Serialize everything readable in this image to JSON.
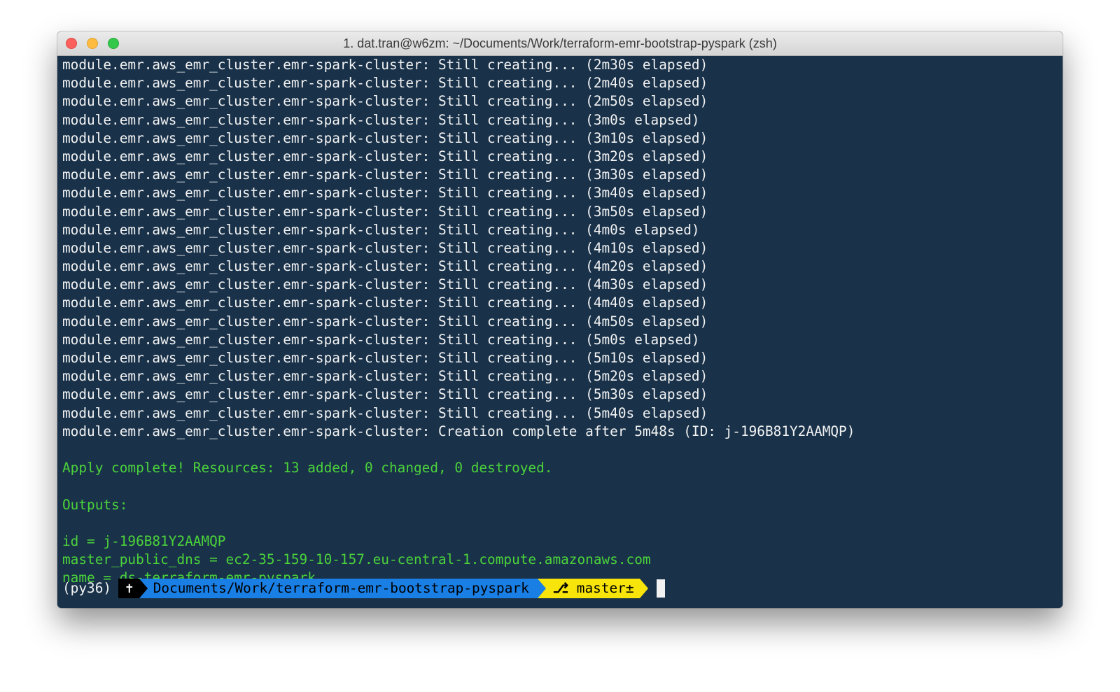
{
  "window": {
    "title": "1. dat.tran@w6zm: ~/Documents/Work/terraform-emr-bootstrap-pyspark (zsh)"
  },
  "terminal": {
    "lines": [
      {
        "text": "module.emr.aws_emr_cluster.emr-spark-cluster: Still creating... (2m30s elapsed)",
        "style": "normal"
      },
      {
        "text": "module.emr.aws_emr_cluster.emr-spark-cluster: Still creating... (2m40s elapsed)",
        "style": "normal"
      },
      {
        "text": "module.emr.aws_emr_cluster.emr-spark-cluster: Still creating... (2m50s elapsed)",
        "style": "normal"
      },
      {
        "text": "module.emr.aws_emr_cluster.emr-spark-cluster: Still creating... (3m0s elapsed)",
        "style": "normal"
      },
      {
        "text": "module.emr.aws_emr_cluster.emr-spark-cluster: Still creating... (3m10s elapsed)",
        "style": "normal"
      },
      {
        "text": "module.emr.aws_emr_cluster.emr-spark-cluster: Still creating... (3m20s elapsed)",
        "style": "normal"
      },
      {
        "text": "module.emr.aws_emr_cluster.emr-spark-cluster: Still creating... (3m30s elapsed)",
        "style": "normal"
      },
      {
        "text": "module.emr.aws_emr_cluster.emr-spark-cluster: Still creating... (3m40s elapsed)",
        "style": "normal"
      },
      {
        "text": "module.emr.aws_emr_cluster.emr-spark-cluster: Still creating... (3m50s elapsed)",
        "style": "normal"
      },
      {
        "text": "module.emr.aws_emr_cluster.emr-spark-cluster: Still creating... (4m0s elapsed)",
        "style": "normal"
      },
      {
        "text": "module.emr.aws_emr_cluster.emr-spark-cluster: Still creating... (4m10s elapsed)",
        "style": "normal"
      },
      {
        "text": "module.emr.aws_emr_cluster.emr-spark-cluster: Still creating... (4m20s elapsed)",
        "style": "normal"
      },
      {
        "text": "module.emr.aws_emr_cluster.emr-spark-cluster: Still creating... (4m30s elapsed)",
        "style": "normal"
      },
      {
        "text": "module.emr.aws_emr_cluster.emr-spark-cluster: Still creating... (4m40s elapsed)",
        "style": "normal"
      },
      {
        "text": "module.emr.aws_emr_cluster.emr-spark-cluster: Still creating... (4m50s elapsed)",
        "style": "normal"
      },
      {
        "text": "module.emr.aws_emr_cluster.emr-spark-cluster: Still creating... (5m0s elapsed)",
        "style": "normal"
      },
      {
        "text": "module.emr.aws_emr_cluster.emr-spark-cluster: Still creating... (5m10s elapsed)",
        "style": "normal"
      },
      {
        "text": "module.emr.aws_emr_cluster.emr-spark-cluster: Still creating... (5m20s elapsed)",
        "style": "normal"
      },
      {
        "text": "module.emr.aws_emr_cluster.emr-spark-cluster: Still creating... (5m30s elapsed)",
        "style": "normal"
      },
      {
        "text": "module.emr.aws_emr_cluster.emr-spark-cluster: Still creating... (5m40s elapsed)",
        "style": "normal"
      },
      {
        "text": "module.emr.aws_emr_cluster.emr-spark-cluster: Creation complete after 5m48s (ID: j-196B81Y2AAMQP)",
        "style": "normal"
      },
      {
        "text": "",
        "style": "normal"
      },
      {
        "text": "Apply complete! Resources: 13 added, 0 changed, 0 destroyed.",
        "style": "green"
      },
      {
        "text": "",
        "style": "normal"
      },
      {
        "text": "Outputs:",
        "style": "green"
      },
      {
        "text": "",
        "style": "normal"
      },
      {
        "text": "id = j-196B81Y2AAMQP",
        "style": "green"
      },
      {
        "text": "master_public_dns = ec2-35-159-10-157.eu-central-1.compute.amazonaws.com",
        "style": "green"
      },
      {
        "text": "name = ds-terraform-emr-pyspark",
        "style": "green"
      }
    ],
    "prompt": {
      "venv": "(py36)",
      "user_glyph": "✝",
      "path": "Documents/Work/terraform-emr-bootstrap-pyspark",
      "git_icon": "⎇",
      "git_branch": "master±"
    }
  },
  "colors": {
    "background": "#19324a",
    "text": "#f2f2f2",
    "success_green": "#4bd23a",
    "path_segment": "#1a7fe5",
    "git_segment": "#f7e40a"
  },
  "icons": [
    "close-icon",
    "minimize-icon",
    "zoom-icon",
    "git-branch-icon"
  ]
}
